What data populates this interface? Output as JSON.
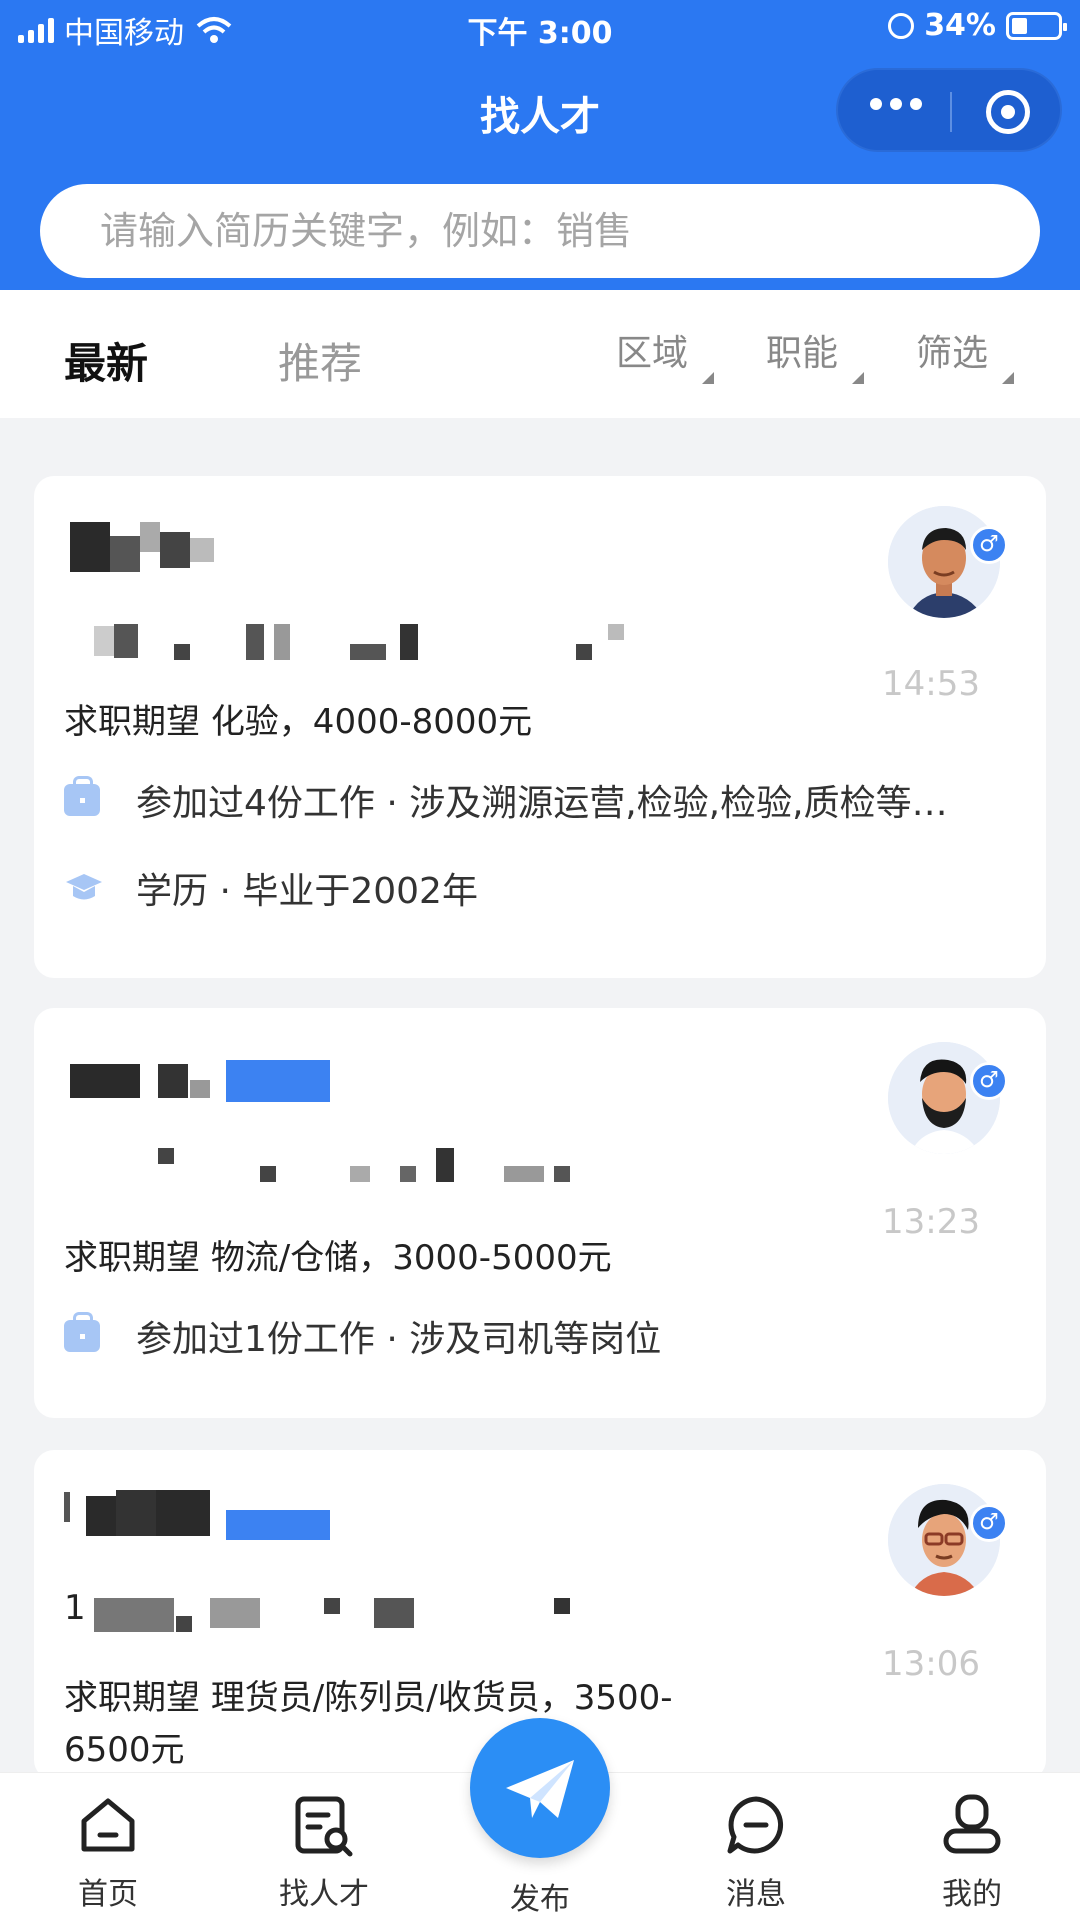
{
  "status_bar": {
    "carrier": "中国移动",
    "time": "下午 3:00",
    "battery": "34%",
    "battery_level": 0.34
  },
  "navbar": {
    "title": "找人才"
  },
  "search": {
    "placeholder": "请输入简历关键字，例如：销售"
  },
  "tabs": {
    "latest": "最新",
    "recommend": "推荐"
  },
  "filters": {
    "area": "区域",
    "function": "职能",
    "screen": "筛选"
  },
  "cards": [
    {
      "time": "14:53",
      "expect_prefix": "求职期望",
      "expect": "化验，4000-8000元",
      "work": "参加过4份工作 · 涉及溯源运营,检验,检验,质检等…",
      "edu": "学历 · 毕业于2002年",
      "gender_icon": "male-icon"
    },
    {
      "time": "13:23",
      "expect_prefix": "求职期望",
      "expect": "物流/仓储，3000-5000元",
      "work": "参加过1份工作 · 涉及司机等岗位",
      "gender_icon": "male-icon"
    },
    {
      "time": "13:06",
      "expect_prefix": "求职期望",
      "expect": "理货员/陈列员/收货员，3500-",
      "expect_line2": "6500元",
      "gender_icon": "male-icon"
    }
  ],
  "tabbar": {
    "home": "首页",
    "find": "找人才",
    "publish": "发布",
    "messages": "消息",
    "mine": "我的"
  },
  "colors": {
    "primary": "#2b78f2",
    "publish_button": "#2b8ef5",
    "icon_light": "#a7c6f5"
  }
}
